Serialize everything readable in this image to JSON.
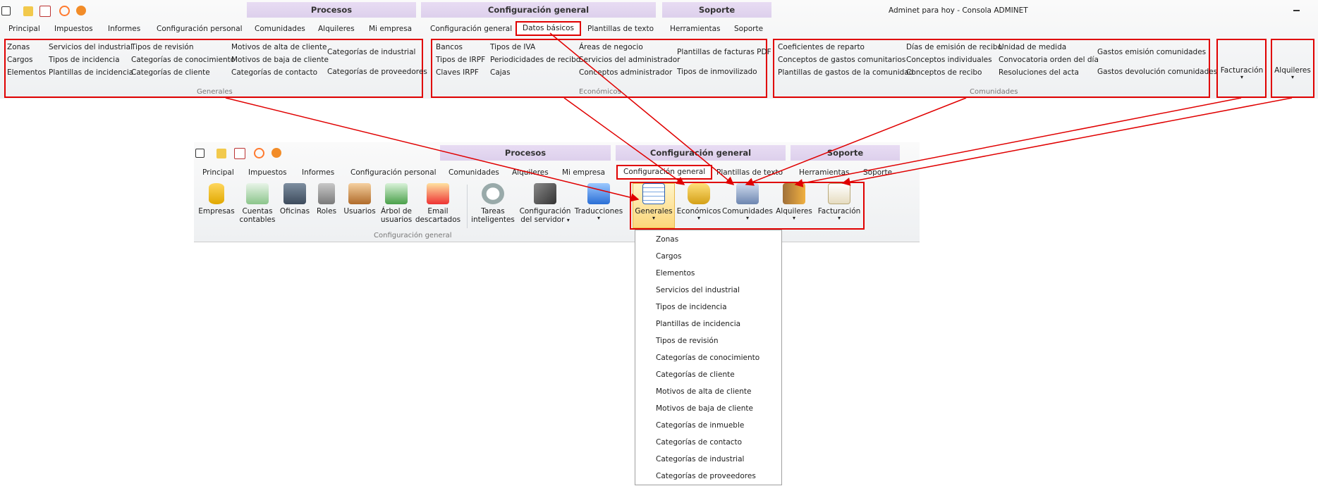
{
  "top": {
    "window_title": "Adminet para hoy - Consola ADMINET",
    "context_labels": [
      "Procesos",
      "Configuración general",
      "Soporte"
    ],
    "tabs": [
      "Principal",
      "Impuestos",
      "Informes",
      "Configuración personal",
      "Comunidades",
      "Alquileres",
      "Mi empresa",
      "Configuración general",
      "Datos básicos",
      "Plantillas de texto",
      "Herramientas",
      "Soporte"
    ],
    "groups": {
      "generales": {
        "label": "Generales",
        "cols": [
          [
            "Zonas",
            "Cargos",
            "Elementos"
          ],
          [
            "Servicios del industrial",
            "Tipos de incidencia",
            "Plantillas de incidencia"
          ],
          [
            "Tipos de revisión",
            "Categorías de conocimiento",
            "Categorías de cliente"
          ],
          [
            "Motivos de alta de cliente",
            "Motivos de baja de cliente",
            "Categorías de contacto"
          ],
          [
            "Categorías de industrial",
            "Categorías de proveedores"
          ]
        ]
      },
      "economicos": {
        "label": "Económicos",
        "cols": [
          [
            "Bancos",
            "Tipos de IRPF",
            "Claves IRPF"
          ],
          [
            "Tipos de IVA",
            "Periodicidades de recibo",
            "Cajas"
          ],
          [
            "Áreas de negocio",
            "Servicios del administrador",
            "Conceptos administrador"
          ],
          [
            "Plantillas de facturas PDF",
            "Tipos de inmovilizado"
          ]
        ]
      },
      "comunidades": {
        "label": "Comunidades",
        "cols": [
          [
            "Coeficientes de reparto",
            "Conceptos de gastos comunitarios",
            "Plantillas de gastos de la comunidad"
          ],
          [
            "Días de emisión de recibo",
            "Conceptos individuales",
            "Conceptos de recibo"
          ],
          [
            "Unidad de medida",
            "Convocatoria orden del día",
            "Resoluciones del acta"
          ],
          [
            "Gastos emisión comunidades",
            "Gastos devolución comunidades"
          ]
        ]
      },
      "facturacion": "Facturación",
      "alquileres": "Alquileres"
    }
  },
  "bottom": {
    "context_labels": [
      "Procesos",
      "Configuración general",
      "Soporte"
    ],
    "tabs": [
      "Principal",
      "Impuestos",
      "Informes",
      "Configuración personal",
      "Comunidades",
      "Alquileres",
      "Mi empresa",
      "Configuración general",
      "Plantillas de texto",
      "Herramientas",
      "Soporte"
    ],
    "buttons": [
      [
        "Empresas"
      ],
      [
        "Cuentas",
        "contables"
      ],
      [
        "Oficinas"
      ],
      [
        "Roles"
      ],
      [
        "Usuarios"
      ],
      [
        "Árbol de",
        "usuarios"
      ],
      [
        "Email",
        "descartados"
      ],
      [
        "Tareas",
        "inteligentes"
      ],
      [
        "Configuración",
        "del servidor"
      ],
      [
        "Traducciones"
      ],
      [
        "Generales"
      ],
      [
        "Económicos"
      ],
      [
        "Comunidades"
      ],
      [
        "Alquileres"
      ],
      [
        "Facturación"
      ]
    ],
    "group_label": "Configuración general",
    "menu": [
      "Zonas",
      "Cargos",
      "Elementos",
      "Servicios del industrial",
      "Tipos de incidencia",
      "Plantillas de incidencia",
      "Tipos de revisión",
      "Categorías de conocimiento",
      "Categorías de cliente",
      "Motivos de alta de cliente",
      "Motivos de baja de cliente",
      "Categorías de inmueble",
      "Categorías de contacto",
      "Categorías de industrial",
      "Categorías de proveedores"
    ]
  },
  "colors": {
    "highlight": "#e00000",
    "context_band": "#e0d3ee",
    "selected_button": "#fce39a"
  },
  "icons": [
    "home-icon",
    "mail-icon",
    "notes-icon",
    "broadcast-icon",
    "mascot-icon",
    "minimize-icon",
    "database-icon",
    "ledger-icon",
    "servers-icon",
    "lock-icon",
    "users-icon",
    "tree-icon",
    "blocked-mail-icon",
    "clock-icon",
    "tools-icon",
    "translate-icon",
    "table-icon",
    "coins-icon",
    "building-icon",
    "door-icon",
    "invoice-icon"
  ]
}
